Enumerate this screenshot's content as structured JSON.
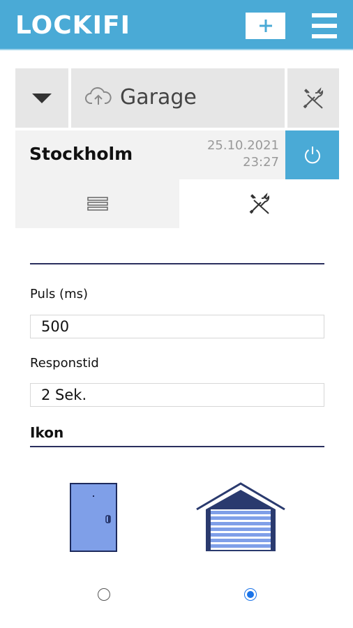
{
  "header": {
    "logo": "LOCKIFI",
    "add_icon": "plus-icon",
    "menu_icon": "hamburger-menu-icon",
    "color": "#4aaad6"
  },
  "device_bar": {
    "dropdown_icon": "caret-down-icon",
    "cloud_icon": "cloud-upload-icon",
    "device_name": "Garage",
    "tools_icon": "wrench-screwdriver-icon"
  },
  "location": {
    "name": "Stockholm",
    "date": "25.10.2021",
    "time": "23:27",
    "power_icon": "power-icon"
  },
  "tabs": {
    "list_icon": "list-icon",
    "settings_icon": "wrench-screwdriver-icon",
    "active": "settings"
  },
  "form": {
    "pulse_label": "Puls (ms)",
    "pulse_value": "500",
    "response_label": "Responstid",
    "response_value": "2 Sek.",
    "icon_section_title": "Ikon"
  },
  "icon_choice": {
    "options": [
      "door-icon",
      "garage-icon"
    ],
    "selected": "garage-icon"
  }
}
